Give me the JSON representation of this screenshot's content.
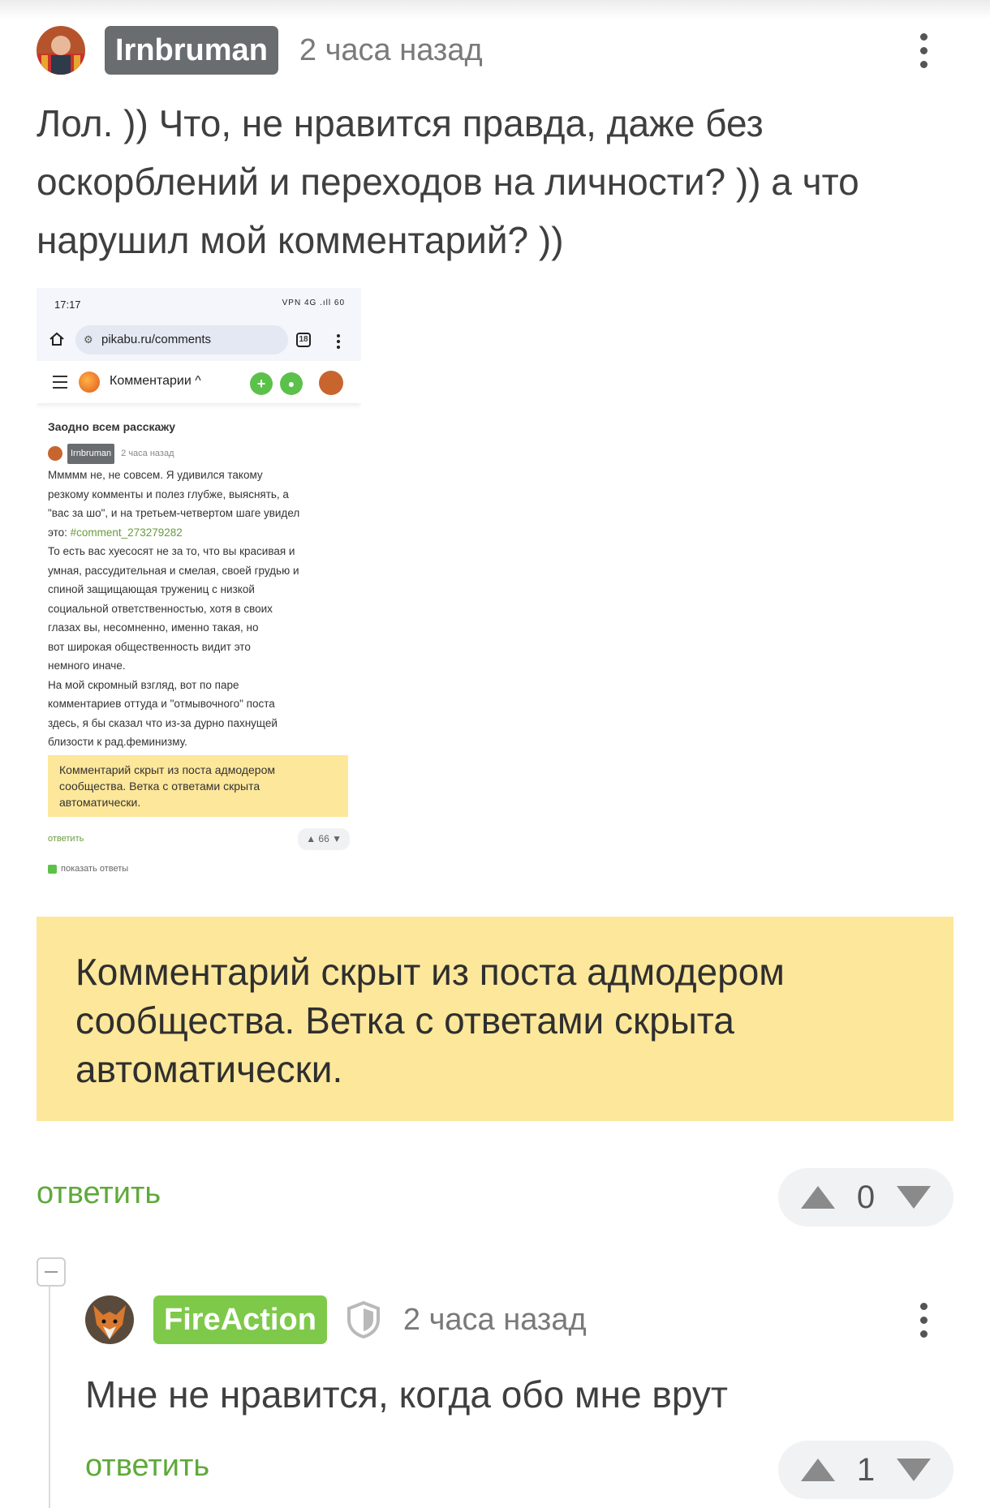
{
  "comment1": {
    "author": "Irnbruman",
    "time": "2 часа назад",
    "text_lines": [
      "Лол. )) Что, не нравится правда, даже без",
      "оскорблений и переходов на личности? )) а что",
      "нарушил мой комментарий? ))"
    ],
    "reply_label": "ответить",
    "votes": "0"
  },
  "screenshot": {
    "status_time": "17:17",
    "status_icons": "VPN 4G .ıll 60",
    "url": "pikabu.ru/comments",
    "tab_count": "18",
    "app_title": "Комментарии ^",
    "post_title": "Заодно всем расскажу",
    "author": "Irnbruman",
    "time": "2 часа назад",
    "lines": [
      "Ммммм не, не совсем. Я удивился такому",
      "резкому комменты и полез глубже, выяснять, а",
      "\"вас за шо\", и на третьем-четвертом шаге увидел"
    ],
    "line4_prefix": "это: ",
    "line4_link": "#comment_273279282",
    "lines2": [
      "То есть вас хуесосят не за то, что вы красивая и",
      "умная, рассудительная и смелая, своей грудью и",
      "спиной защищающая тружениц с низкой",
      "социальной ответственностью, хотя в своих",
      "глазах вы, несомненно, именно такая, но",
      "вот широкая общественность видит это",
      "немного иначе.",
      "На мой скромный взгляд, вот по паре",
      "комментариев оттуда и \"отмывочного\" поста",
      "здесь, я бы сказал что из-за дурно пахнущей",
      "близости к рад.феминизму."
    ],
    "note": "Комментарий скрыт из поста адмодером сообщества. Ветка с ответами скрыта автоматически.",
    "reply": "ответить",
    "votes": "66",
    "show_replies": "показать ответы"
  },
  "banner": {
    "text": "Комментарий скрыт из поста адмодером сообщества. Ветка с ответами скрыта автоматически."
  },
  "comment2": {
    "author": "FireAction",
    "time": "2 часа назад",
    "text": "Мне не нравится, когда обо мне врут",
    "reply_label": "ответить",
    "votes": "1"
  },
  "colors": {
    "accent_green": "#5ea93a",
    "nick_grey": "#6a6d70",
    "nick_green": "#7ec94a",
    "banner_yellow": "#fde79a"
  },
  "icons": [
    "avatar-irnbruman",
    "avatar-fireaction",
    "more-vert-icon",
    "shield-icon",
    "upvote-icon",
    "downvote-icon",
    "collapse-icon"
  ]
}
